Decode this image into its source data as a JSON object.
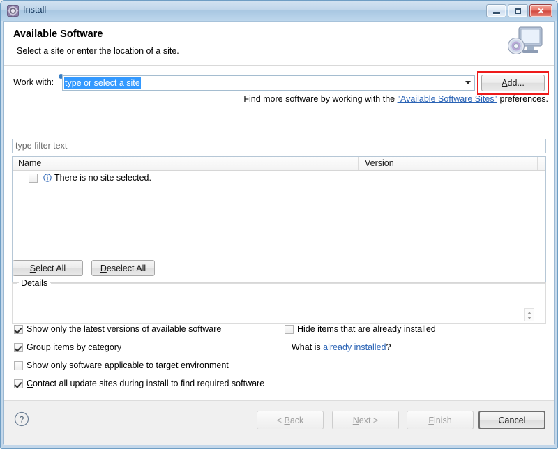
{
  "window": {
    "title": "Install",
    "icon": "install-gear-icon",
    "controls": {
      "minimize": "minimize-icon",
      "maximize": "maximize-icon",
      "close": "close-icon"
    }
  },
  "header": {
    "title": "Available Software",
    "subtitle": "Select a site or enter the location of a site.",
    "icon": "monitor-disc-icon"
  },
  "work_with": {
    "label_prefix": "W",
    "label_rest": "ork with:",
    "label_full": "Work with:",
    "value": "type or select a site",
    "placeholder": "type or select a site",
    "dropdown_icon": "chevron-down-icon",
    "info_indicator": "info-dot-icon"
  },
  "add_button": {
    "label_prefix": "A",
    "label_rest": "dd...",
    "label_full": "Add...",
    "highlight_color": "#ee1b1b"
  },
  "find_more": {
    "before": "Find more software by working with the ",
    "link": "\"Available Software Sites\"",
    "after": " preferences."
  },
  "filter": {
    "placeholder": "type filter text",
    "value": ""
  },
  "table": {
    "columns": [
      "Name",
      "Version"
    ],
    "rows": [
      {
        "checked": false,
        "icon": "info-circle-icon",
        "name": "There is no site selected.",
        "version": ""
      }
    ]
  },
  "selection_buttons": {
    "select_all_prefix": "S",
    "select_all_rest": "elect All",
    "select_all_full": "Select All",
    "deselect_all_prefix": "D",
    "deselect_all_rest": "eselect All",
    "deselect_all_full": "Deselect All"
  },
  "details": {
    "group_label": "Details",
    "content": "",
    "spinner_icon": "up-down-spinner-icon"
  },
  "options": {
    "left": [
      {
        "checked": true,
        "pre": "Show only the ",
        "acc": "l",
        "post": "atest versions of available software",
        "full": "Show only the latest versions of available software"
      },
      {
        "checked": true,
        "pre": "",
        "acc": "G",
        "post": "roup items by category",
        "full": "Group items by category"
      },
      {
        "checked": false,
        "pre": "",
        "acc": "",
        "post": "Show only software applicable to target environment",
        "full": "Show only software applicable to target environment"
      },
      {
        "checked": true,
        "pre": "",
        "acc": "C",
        "post": "ontact all update sites during install to find required software",
        "full": "Contact all update sites during install to find required software"
      }
    ],
    "right": [
      {
        "checked": false,
        "pre": "",
        "acc": "H",
        "post": "ide items that are already installed",
        "full": "Hide items that are already installed"
      }
    ],
    "already_installed_question": {
      "before": "What is ",
      "link": "already installed",
      "after": "?"
    }
  },
  "footer": {
    "help_icon": "help-question-icon",
    "buttons": [
      {
        "label": "< Back",
        "acc_pre": "< ",
        "acc": "B",
        "acc_post": "ack",
        "enabled": false,
        "default": false
      },
      {
        "label": "Next >",
        "acc_pre": "",
        "acc": "N",
        "acc_post": "ext >",
        "enabled": false,
        "default": false
      },
      {
        "label": "Finish",
        "acc_pre": "",
        "acc": "F",
        "acc_post": "inish",
        "enabled": false,
        "default": false
      },
      {
        "label": "Cancel",
        "acc_pre": "",
        "acc": "",
        "acc_post": "Cancel",
        "enabled": true,
        "default": true
      }
    ]
  },
  "colors": {
    "selection_blue": "#3399ff",
    "link_blue": "#2a63b5",
    "highlight_red": "#ee1b1b",
    "titlebar_blue": "#bed5ea"
  }
}
